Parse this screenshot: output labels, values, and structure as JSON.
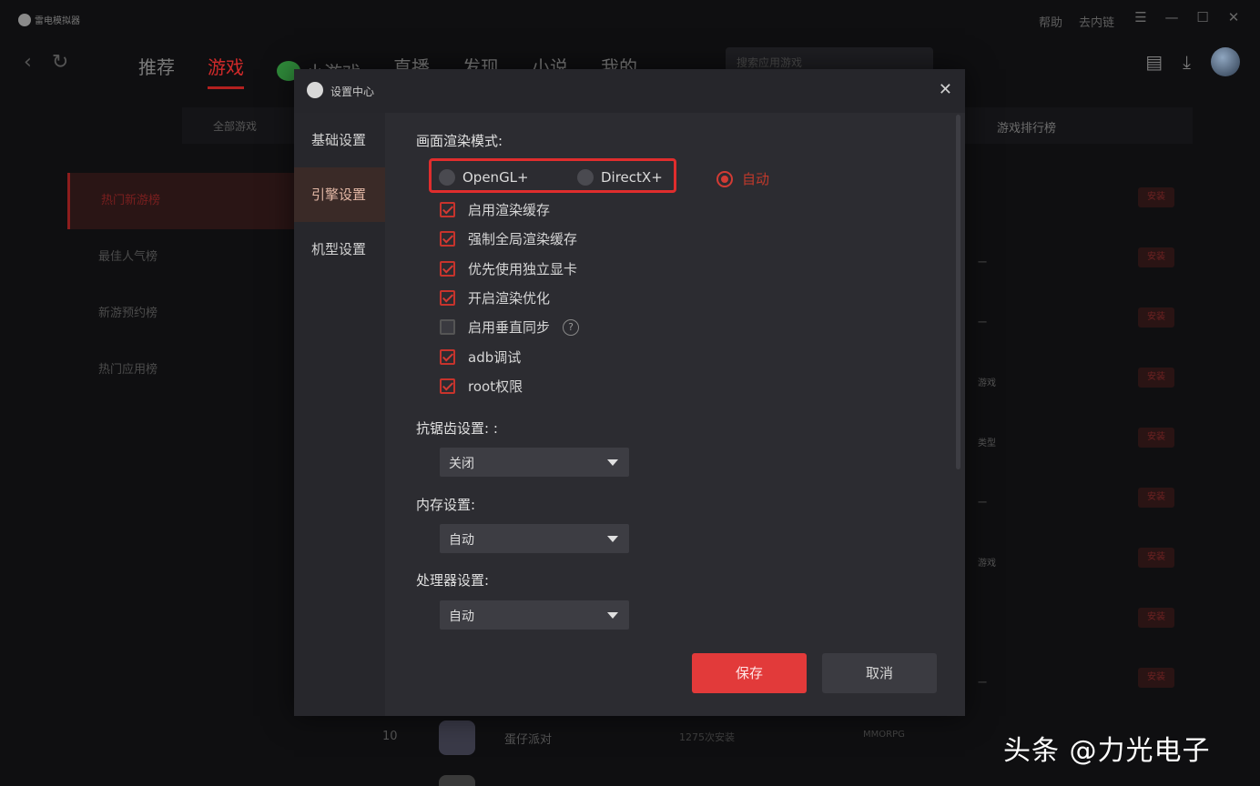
{
  "app": {
    "logo_text": "雷电模拟器",
    "top_links": [
      "帮助",
      "去内链"
    ],
    "window_controls": [
      "menu-icon",
      "minimize-icon",
      "maximize-icon",
      "close-icon"
    ]
  },
  "nav": {
    "tabs": [
      "推荐",
      "游戏",
      "小游戏",
      "直播",
      "发现",
      "小说",
      "我的"
    ],
    "active_tab": "游戏",
    "search_placeholder": "搜索应用游戏"
  },
  "subbar": {
    "all_label": "全部游戏",
    "rank_label": "游戏排行榜"
  },
  "left_list": [
    "热门新游榜",
    "最佳人气榜",
    "新游预约榜",
    "热门应用榜"
  ],
  "bg_rows": [
    {
      "tag": "",
      "button": "安装"
    },
    {
      "tag": "一",
      "button": "安装"
    },
    {
      "tag": "一",
      "button": "安装"
    },
    {
      "tag": "游戏",
      "button": "安装"
    },
    {
      "tag": "类型",
      "button": "安装"
    },
    {
      "tag": "一",
      "button": "安装"
    },
    {
      "tag": "游戏",
      "button": "安装"
    },
    {
      "tag": "",
      "button": "安装"
    },
    {
      "tag": "一",
      "button": "安装"
    }
  ],
  "bottom_game": {
    "rank": "10",
    "name": "蛋仔派对",
    "desc": "1275次安装",
    "tag": "MMORPG"
  },
  "watermark": "头条 @力光电子",
  "dialog": {
    "title": "设置中心",
    "sidebar": [
      "基础设置",
      "引擎设置",
      "机型设置"
    ],
    "active_sidebar": "引擎设置",
    "render_mode_label": "画面渲染模式:",
    "render_options": [
      "OpenGL+",
      "DirectX+",
      "自动"
    ],
    "render_selected": "自动",
    "checkboxes": [
      {
        "label": "启用渲染缓存",
        "checked": true
      },
      {
        "label": "强制全局渲染缓存",
        "checked": true
      },
      {
        "label": "优先使用独立显卡",
        "checked": true
      },
      {
        "label": "开启渲染优化",
        "checked": true
      },
      {
        "label": "启用垂直同步",
        "checked": false
      },
      {
        "label": "adb调试",
        "checked": true
      },
      {
        "label": "root权限",
        "checked": true
      }
    ],
    "antialias_label": "抗锯齿设置: :",
    "antialias_value": "关闭",
    "memory_label": "内存设置:",
    "memory_value": "自动",
    "cpu_label": "处理器设置:",
    "cpu_value": "自动",
    "save_label": "保存",
    "cancel_label": "取消",
    "help_glyph": "?",
    "close_glyph": "✕"
  },
  "colors": {
    "accent": "#e23a3a",
    "dialog_bg": "#2c2c31",
    "highlight_box": "#e02d2d"
  }
}
